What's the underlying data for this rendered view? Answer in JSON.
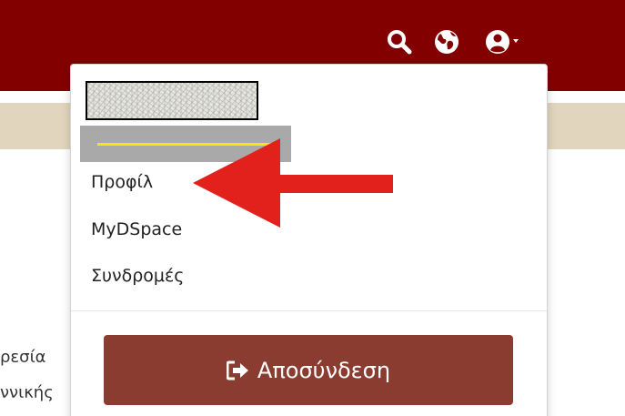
{
  "header": {
    "icons": [
      "search-icon",
      "globe-icon",
      "user-icon",
      "caret-down-icon"
    ],
    "brand_color": "#820000",
    "subbar_color": "#e2d5bd"
  },
  "background": {
    "text_line_1": "ρεσία",
    "text_line_2": "ννικής"
  },
  "user_menu": {
    "items": [
      {
        "label": "Προφίλ"
      },
      {
        "label": "MyDSpace"
      },
      {
        "label": "Συνδρομές"
      }
    ],
    "logout_label": "Αποσύνδεση",
    "logout_icon": "sign-out-icon",
    "logout_color": "#8b3c31"
  },
  "annotation": {
    "arrow_color": "#e3211c",
    "arrow_target": "Προφίλ"
  }
}
